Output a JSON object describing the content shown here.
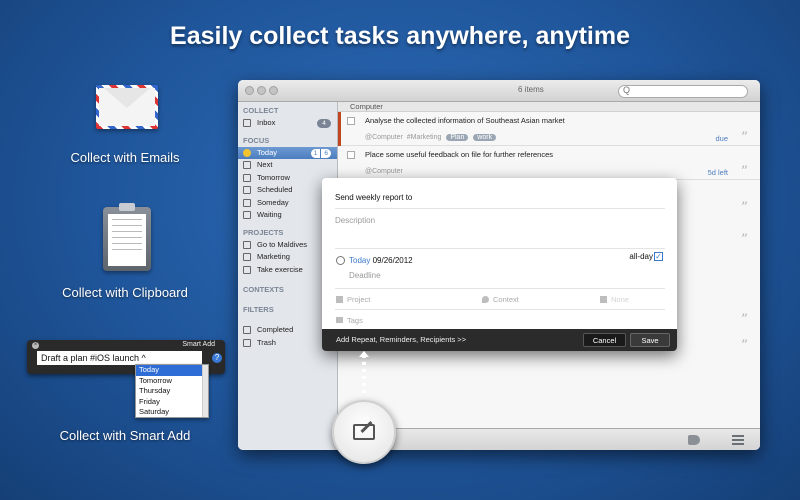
{
  "headline": "Easily collect tasks anywhere, anytime",
  "features": {
    "emails": "Collect with Emails",
    "clipboard": "Collect with Clipboard",
    "smart_add": "Collect with Smart Add"
  },
  "smart_add_panel": {
    "title": "Smart Add",
    "input_value": "Draft a plan #iOS launch  ^",
    "help": "?",
    "options": [
      "Today",
      "Tomorrow",
      "Thursday",
      "Friday",
      "Saturday"
    ],
    "selected": "Today"
  },
  "window": {
    "items_count": "6 items",
    "search_placeholder": "Q"
  },
  "sidebar": {
    "collect_header": "COLLECT",
    "inbox": {
      "label": "Inbox",
      "badge": "4"
    },
    "focus_header": "FOCUS",
    "today": {
      "label": "Today",
      "badge_a": "1",
      "badge_b": "6"
    },
    "focus_items": [
      "Next",
      "Tomorrow",
      "Scheduled",
      "Someday",
      "Waiting"
    ],
    "projects_header": "PROJECTS",
    "projects": [
      "Go to Maldives",
      "Marketing",
      "Take exercise"
    ],
    "contexts_header": "CONTEXTS",
    "filters_header": "FILTERS",
    "filters": [
      "Completed",
      "Trash"
    ]
  },
  "task_list": {
    "group": "Computer",
    "tasks": [
      {
        "title": "Analyse the collected information of Southeast Asian market",
        "context": "@Computer",
        "tag_text": "#Marketing",
        "tags": [
          "Plan",
          "work"
        ],
        "due": "due"
      },
      {
        "title": "Place some useful feedback on file for further references",
        "context": "@Computer",
        "due": "5d left"
      }
    ]
  },
  "quick_entry": {
    "title_value": "Send weekly report to",
    "description_placeholder": "Description",
    "date_today": "Today",
    "date_value": "09/26/2012",
    "all_day": "all-day",
    "deadline": "Deadline",
    "project": "Project",
    "context": "Context",
    "state": "None",
    "tags": "Tags",
    "more_link": "Add Repeat, Reminders, Recipients >>",
    "cancel": "Cancel",
    "save": "Save"
  },
  "colors": {
    "background": "#1f559a",
    "accent": "#c1461d",
    "selection": "#4c7dbf"
  }
}
